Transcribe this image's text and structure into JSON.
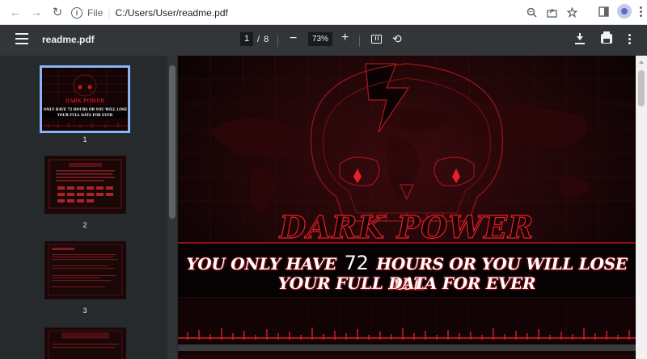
{
  "browser": {
    "scheme": "File",
    "url": "C:/Users/User/readme.pdf"
  },
  "toolbar": {
    "title": "readme.pdf",
    "page_current": "1",
    "page_total": "8",
    "page_separator": "/",
    "zoom": "73%"
  },
  "sidebar": {
    "thumbnails": [
      {
        "page": "1",
        "selected": true
      },
      {
        "page": "2",
        "selected": false
      },
      {
        "page": "3",
        "selected": false
      }
    ]
  },
  "page": {
    "brand": "DARK POWER",
    "line1_before": "YOU ONLY HAVE",
    "hours": "72",
    "line1_after": "HOURS OR YOU WILL LOSE ALL",
    "line2": "YOUR FULL DATA FOR EVER"
  },
  "colors": {
    "toolbar_bg": "#323639",
    "sidebar_bg": "#262a2d",
    "accent_red": "#e8202a",
    "selection_blue": "#8ab4f8"
  },
  "icons": {
    "back": "arrow-left-icon",
    "forward": "arrow-right-icon",
    "reload": "reload-icon",
    "info": "info-icon",
    "zoom": "magnifier-icon",
    "share": "share-icon",
    "bookmark": "star-icon",
    "side_panel": "side-panel-icon",
    "profile": "avatar-icon",
    "browser_menu": "kebab-icon",
    "menu": "hamburger-icon",
    "fit": "fit-page-icon",
    "rotate": "rotate-icon",
    "download": "download-icon",
    "print": "print-icon",
    "more": "kebab-icon"
  }
}
